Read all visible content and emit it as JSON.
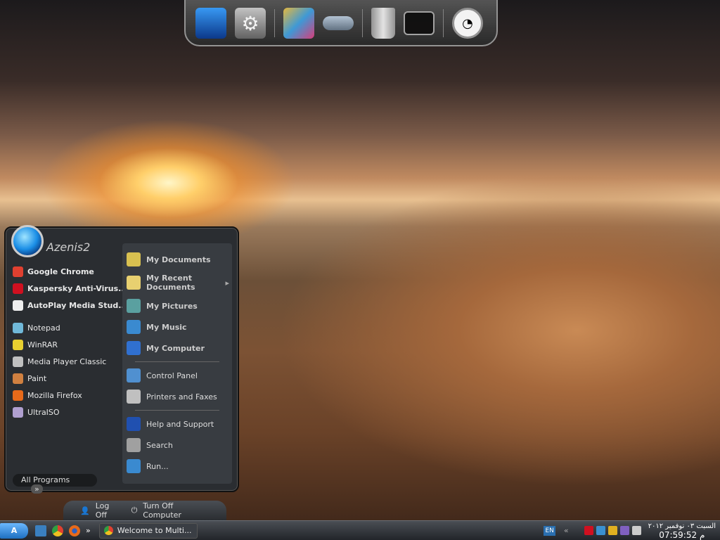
{
  "dock": {
    "icons": [
      "monitor-icon",
      "settings-gear-icon",
      "media-gallery-icon",
      "hard-drive-icon",
      "recycle-bin-icon",
      "display-icon",
      "clock-icon"
    ]
  },
  "start_menu": {
    "user": "Azenis2",
    "pinned": [
      {
        "label": "Google Chrome",
        "icon": "chrome-icon",
        "color": "#e04030"
      },
      {
        "label": "Kaspersky Anti-Virus...",
        "icon": "kaspersky-icon",
        "color": "#d01020"
      },
      {
        "label": "AutoPlay Media Stud...",
        "icon": "document-icon",
        "color": "#eeeeee"
      }
    ],
    "recent": [
      {
        "label": "Notepad",
        "icon": "notepad-icon",
        "color": "#70b8d8"
      },
      {
        "label": "WinRAR",
        "icon": "winrar-icon",
        "color": "#e8d030"
      },
      {
        "label": "Media Player Classic",
        "icon": "media-player-icon",
        "color": "#c0c0c0"
      },
      {
        "label": "Paint",
        "icon": "paint-icon",
        "color": "#d08040"
      },
      {
        "label": "Mozilla Firefox",
        "icon": "firefox-icon",
        "color": "#e86a1a"
      },
      {
        "label": "UltraISO",
        "icon": "ultraiso-icon",
        "color": "#b0a0d0"
      }
    ],
    "places": [
      {
        "label": "My Documents",
        "icon": "my-documents-icon",
        "color": "#d8c050"
      },
      {
        "label": "My Recent Documents",
        "icon": "recent-documents-icon",
        "color": "#e8d070"
      },
      {
        "label": "My Pictures",
        "icon": "my-pictures-icon",
        "color": "#5aa0a0"
      },
      {
        "label": "My Music",
        "icon": "my-music-icon",
        "color": "#3a8ad0"
      },
      {
        "label": "My Computer",
        "icon": "my-computer-icon",
        "color": "#3070d0"
      }
    ],
    "system": [
      {
        "label": "Control Panel",
        "icon": "control-panel-icon",
        "color": "#5090d0"
      },
      {
        "label": "Printers and Faxes",
        "icon": "printer-icon",
        "color": "#c0c0c0"
      }
    ],
    "help": [
      {
        "label": "Help and Support",
        "icon": "help-icon",
        "color": "#2050b0"
      },
      {
        "label": "Search",
        "icon": "search-icon",
        "color": "#a0a0a0"
      },
      {
        "label": "Run...",
        "icon": "run-icon",
        "color": "#3a8ad0"
      }
    ],
    "all_programs": "All Programs",
    "all_programs_arrow": "»",
    "log_off": "Log Off",
    "turn_off": "Turn Off Computer"
  },
  "taskbar": {
    "start": "A",
    "quick_launch": [
      "show-desktop-icon",
      "chrome-icon",
      "firefox-icon"
    ],
    "overflow": "»",
    "tasks": [
      {
        "label": "Welcome to Multi...",
        "icon": "chrome-icon"
      }
    ],
    "language": "EN",
    "tray_expand": "«",
    "clock_date": "السبت ٠٣ نوفمبر ٢٠١٢",
    "clock_time": "07:59:52 م"
  }
}
